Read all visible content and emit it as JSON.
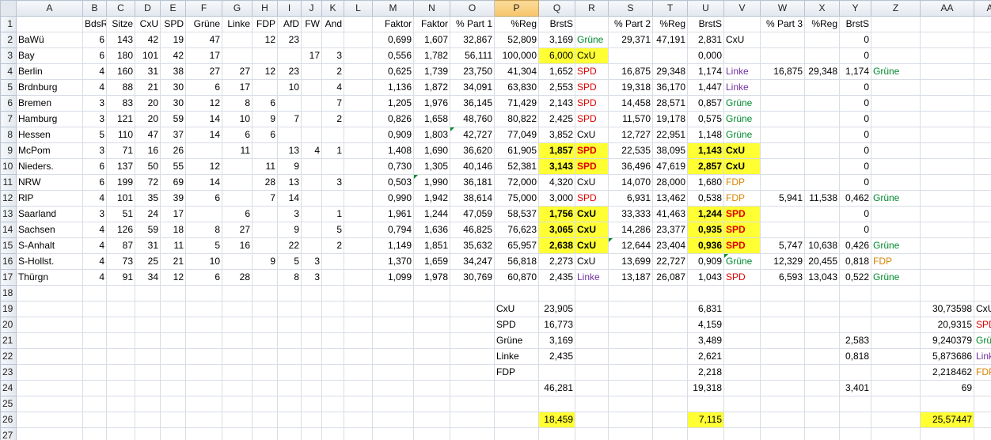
{
  "columns": [
    "A",
    "B",
    "C",
    "D",
    "E",
    "F",
    "G",
    "H",
    "I",
    "J",
    "K",
    "L",
    "M",
    "N",
    "O",
    "P",
    "Q",
    "R",
    "S",
    "T",
    "U",
    "V",
    "W",
    "X",
    "Y",
    "Z",
    "AA",
    "AB"
  ],
  "selected_column": "P",
  "party_colors": {
    "CxU": "#000000",
    "SPD": "#e00000",
    "Grüne": "#008a2e",
    "Linke": "#7030a0",
    "FDP": "#d88400"
  },
  "highlight_color": "#ffff33",
  "rows": [
    {
      "n": "1",
      "c": {
        "B": "BdsR",
        "C": "Sitze",
        "D": "CxU",
        "E": "SPD",
        "F": "Grüne",
        "G": "Linke",
        "H": "FDP",
        "I": "AfD",
        "J": "FW",
        "K": "And",
        "M": "Faktor",
        "N": "Faktor",
        "O": "% Part 1",
        "P": "%Reg",
        "Q": "BrstS",
        "S": "% Part 2",
        "T": "%Reg",
        "U": "BrstS",
        "W": "% Part 3",
        "X": "%Reg",
        "Y": "BrstS"
      }
    },
    {
      "n": "2",
      "c": {
        "A": "BaWü",
        "B": "6",
        "C": "143",
        "D": "42",
        "E": "19",
        "F": "47",
        "H": "12",
        "I": "23",
        "M": "0,699",
        "N": "1,607",
        "O": "32,867",
        "P": "52,809",
        "Q": "3,169",
        "R": "Grüne",
        "S": "29,371",
        "T": "47,191",
        "U": "2,831",
        "V": "CxU",
        "Y": "0"
      }
    },
    {
      "n": "3",
      "c": {
        "A": "Bay",
        "B": "6",
        "C": "180",
        "D": "101",
        "E": "42",
        "F": "17",
        "J": "17",
        "K": "3",
        "M": "0,556",
        "N": "1,782",
        "O": "56,111",
        "P": "100,000",
        "Q": "6,000",
        "R": "CxU",
        "U": "0,000",
        "Y": "0"
      }
    },
    {
      "n": "4",
      "c": {
        "A": "Berlin",
        "B": "4",
        "C": "160",
        "D": "31",
        "E": "38",
        "F": "27",
        "G": "27",
        "H": "12",
        "I": "23",
        "K": "2",
        "M": "0,625",
        "N": "1,739",
        "O": "23,750",
        "P": "41,304",
        "Q": "1,652",
        "R": "SPD",
        "S": "16,875",
        "T": "29,348",
        "U": "1,174",
        "V": "Linke",
        "W": "16,875",
        "X": "29,348",
        "Y": "1,174",
        "Z": "Grüne"
      }
    },
    {
      "n": "5",
      "c": {
        "A": "Brdnburg",
        "B": "4",
        "C": "88",
        "D": "21",
        "E": "30",
        "F": "6",
        "G": "17",
        "I": "10",
        "K": "4",
        "M": "1,136",
        "N": "1,872",
        "O": "34,091",
        "P": "63,830",
        "Q": "2,553",
        "R": "SPD",
        "S": "19,318",
        "T": "36,170",
        "U": "1,447",
        "V": "Linke",
        "Y": "0"
      }
    },
    {
      "n": "6",
      "c": {
        "A": "Bremen",
        "B": "3",
        "C": "83",
        "D": "20",
        "E": "30",
        "F": "12",
        "G": "8",
        "H": "6",
        "K": "7",
        "M": "1,205",
        "N": "1,976",
        "O": "36,145",
        "P": "71,429",
        "Q": "2,143",
        "R": "SPD",
        "S": "14,458",
        "T": "28,571",
        "U": "0,857",
        "V": "Grüne",
        "Y": "0"
      }
    },
    {
      "n": "7",
      "c": {
        "A": "Hamburg",
        "B": "3",
        "C": "121",
        "D": "20",
        "E": "59",
        "F": "14",
        "G": "10",
        "H": "9",
        "I": "7",
        "K": "2",
        "M": "0,826",
        "N": "1,658",
        "O": "48,760",
        "P": "80,822",
        "Q": "2,425",
        "R": "SPD",
        "S": "11,570",
        "T": "19,178",
        "U": "0,575",
        "V": "Grüne",
        "Y": "0"
      }
    },
    {
      "n": "8",
      "c": {
        "A": "Hessen",
        "B": "5",
        "C": "110",
        "D": "47",
        "E": "37",
        "F": "14",
        "G": "6",
        "H": "6",
        "M": "0,909",
        "N": "1,803",
        "O": "42,727",
        "P": "77,049",
        "Q": "3,852",
        "R": "CxU",
        "S": "12,727",
        "T": "22,951",
        "U": "1,148",
        "V": "Grüne",
        "Y": "0"
      }
    },
    {
      "n": "9",
      "c": {
        "A": "McPom",
        "B": "3",
        "C": "71",
        "D": "16",
        "E": "26",
        "G": "11",
        "I": "13",
        "J": "4",
        "K": "1",
        "M": "1,408",
        "N": "1,690",
        "O": "36,620",
        "P": "61,905",
        "Q": "1,857",
        "R": "SPD",
        "S": "22,535",
        "T": "38,095",
        "U": "1,143",
        "V": "CxU",
        "Y": "0"
      }
    },
    {
      "n": "10",
      "c": {
        "A": "Nieders.",
        "B": "6",
        "C": "137",
        "D": "50",
        "E": "55",
        "F": "12",
        "H": "11",
        "I": "9",
        "M": "0,730",
        "N": "1,305",
        "O": "40,146",
        "P": "52,381",
        "Q": "3,143",
        "R": "SPD",
        "S": "36,496",
        "T": "47,619",
        "U": "2,857",
        "V": "CxU",
        "Y": "0"
      }
    },
    {
      "n": "11",
      "c": {
        "A": "NRW",
        "B": "6",
        "C": "199",
        "D": "72",
        "E": "69",
        "F": "14",
        "H": "28",
        "I": "13",
        "K": "3",
        "M": "0,503",
        "N": "1,990",
        "O": "36,181",
        "P": "72,000",
        "Q": "4,320",
        "R": "CxU",
        "S": "14,070",
        "T": "28,000",
        "U": "1,680",
        "V": "FDP",
        "Y": "0"
      }
    },
    {
      "n": "12",
      "c": {
        "A": "RlP",
        "B": "4",
        "C": "101",
        "D": "35",
        "E": "39",
        "F": "6",
        "H": "7",
        "I": "14",
        "M": "0,990",
        "N": "1,942",
        "O": "38,614",
        "P": "75,000",
        "Q": "3,000",
        "R": "SPD",
        "S": "6,931",
        "T": "13,462",
        "U": "0,538",
        "V": "FDP",
        "W": "5,941",
        "X": "11,538",
        "Y": "0,462",
        "Z": "Grüne"
      }
    },
    {
      "n": "13",
      "c": {
        "A": "Saarland",
        "B": "3",
        "C": "51",
        "D": "24",
        "E": "17",
        "G": "6",
        "I": "3",
        "K": "1",
        "M": "1,961",
        "N": "1,244",
        "O": "47,059",
        "P": "58,537",
        "Q": "1,756",
        "R": "CxU",
        "S": "33,333",
        "T": "41,463",
        "U": "1,244",
        "V": "SPD",
        "Y": "0"
      }
    },
    {
      "n": "14",
      "c": {
        "A": "Sachsen",
        "B": "4",
        "C": "126",
        "D": "59",
        "E": "18",
        "F": "8",
        "G": "27",
        "I": "9",
        "K": "5",
        "M": "0,794",
        "N": "1,636",
        "O": "46,825",
        "P": "76,623",
        "Q": "3,065",
        "R": "CxU",
        "S": "14,286",
        "T": "23,377",
        "U": "0,935",
        "V": "SPD",
        "Y": "0"
      }
    },
    {
      "n": "15",
      "c": {
        "A": "S-Anhalt",
        "B": "4",
        "C": "87",
        "D": "31",
        "E": "11",
        "F": "5",
        "G": "16",
        "I": "22",
        "K": "2",
        "M": "1,149",
        "N": "1,851",
        "O": "35,632",
        "P": "65,957",
        "Q": "2,638",
        "R": "CxU",
        "S": "12,644",
        "T": "23,404",
        "U": "0,936",
        "V": "SPD",
        "W": "5,747",
        "X": "10,638",
        "Y": "0,426",
        "Z": "Grüne"
      }
    },
    {
      "n": "16",
      "c": {
        "A": "S-Hollst.",
        "B": "4",
        "C": "73",
        "D": "25",
        "E": "21",
        "F": "10",
        "H": "9",
        "I": "5",
        "J": "3",
        "M": "1,370",
        "N": "1,659",
        "O": "34,247",
        "P": "56,818",
        "Q": "2,273",
        "R": "CxU",
        "S": "13,699",
        "T": "22,727",
        "U": "0,909",
        "V": "Grüne",
        "W": "12,329",
        "X": "20,455",
        "Y": "0,818",
        "Z": "FDP"
      }
    },
    {
      "n": "17",
      "c": {
        "A": "Thürgn",
        "B": "4",
        "C": "91",
        "D": "34",
        "E": "12",
        "F": "6",
        "G": "28",
        "I": "8",
        "J": "3",
        "M": "1,099",
        "N": "1,978",
        "O": "30,769",
        "P": "60,870",
        "Q": "2,435",
        "R": "Linke",
        "S": "13,187",
        "T": "26,087",
        "U": "1,043",
        "V": "SPD",
        "W": "6,593",
        "X": "13,043",
        "Y": "0,522",
        "Z": "Grüne"
      }
    },
    {
      "n": "18",
      "c": {}
    },
    {
      "n": "19",
      "c": {
        "P": "CxU",
        "Q": "23,905",
        "U": "6,831",
        "AA": "30,73598",
        "AB": "CxU"
      }
    },
    {
      "n": "20",
      "c": {
        "P": "SPD",
        "Q": "16,773",
        "U": "4,159",
        "AA": "20,9315",
        "AB": "SPD"
      }
    },
    {
      "n": "21",
      "c": {
        "P": "Grüne",
        "Q": "3,169",
        "U": "3,489",
        "Y": "2,583",
        "AA": "9,240379",
        "AB": "Grüne"
      }
    },
    {
      "n": "22",
      "c": {
        "P": "Linke",
        "Q": "2,435",
        "U": "2,621",
        "Y": "0,818",
        "AA": "5,873686",
        "AB": "Linke"
      }
    },
    {
      "n": "23",
      "c": {
        "P": "FDP",
        "U": "2,218",
        "AA": "2,218462",
        "AB": "FDP"
      }
    },
    {
      "n": "24",
      "c": {
        "Q": "46,281",
        "U": "19,318",
        "Y": "3,401",
        "AA": "69"
      }
    },
    {
      "n": "25",
      "c": {}
    },
    {
      "n": "26",
      "c": {
        "Q": "18,459",
        "U": "7,115",
        "AA": "25,57447"
      }
    },
    {
      "n": "27",
      "c": {}
    }
  ],
  "highlighted": [
    "Q3",
    "R3",
    "Q9",
    "R9",
    "U9",
    "V9",
    "Q10",
    "R10",
    "U10",
    "V10",
    "Q13",
    "R13",
    "U13",
    "V13",
    "Q14",
    "R14",
    "U14",
    "V14",
    "Q15",
    "R15",
    "U15",
    "V15",
    "Q26",
    "U26",
    "AA26"
  ],
  "bold": [
    "Q9",
    "R9",
    "U9",
    "V9",
    "Q10",
    "R10",
    "U10",
    "V10",
    "Q13",
    "R13",
    "U13",
    "V13",
    "Q14",
    "R14",
    "U14",
    "V14",
    "Q15",
    "R15",
    "U15",
    "V15"
  ],
  "party_cols": [
    "R",
    "V",
    "Z",
    "AB"
  ],
  "text_left_cells": [
    "P19",
    "P20",
    "P21",
    "P22",
    "P23"
  ],
  "comment_markers": [
    "O8",
    "N11",
    "S15",
    "V16"
  ]
}
